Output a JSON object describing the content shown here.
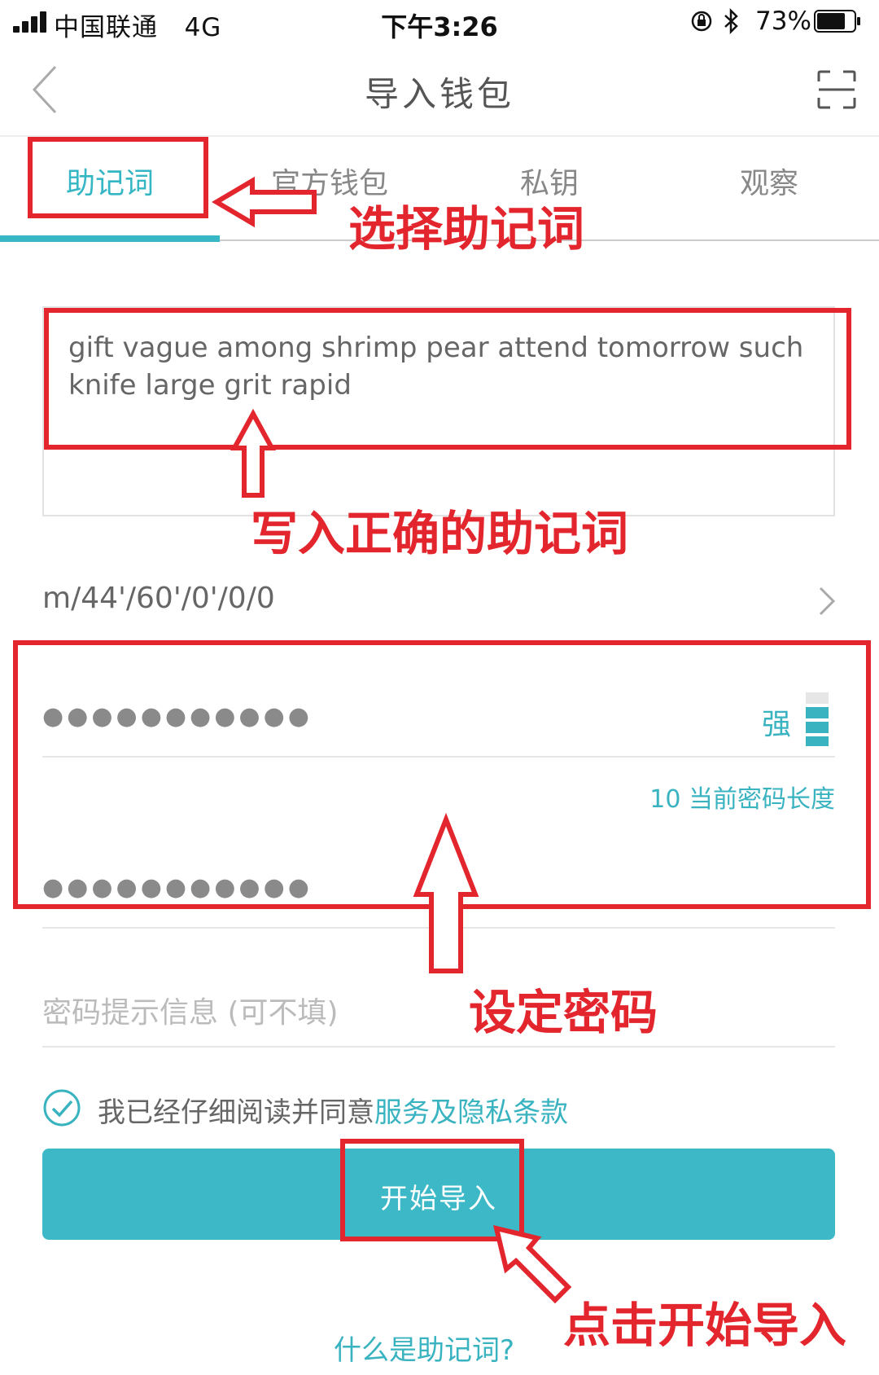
{
  "status_bar": {
    "carrier": "中国联通",
    "network": "4G",
    "time": "下午3:26",
    "battery": "73%"
  },
  "nav": {
    "title": "导入钱包",
    "back_icon": "chevron-left-icon",
    "scan_icon": "scan-icon"
  },
  "tabs": [
    {
      "label": "助记词",
      "active": true
    },
    {
      "label": "官方钱包",
      "active": false
    },
    {
      "label": "私钥",
      "active": false
    },
    {
      "label": "观察",
      "active": false
    }
  ],
  "mnemonic": {
    "value": "gift vague among shrimp pear attend tomorrow such knife large grit rapid"
  },
  "derivation_path": {
    "value": "m/44'/60'/0'/0/0"
  },
  "password": {
    "value_mask": "●●●●●●●●●●●",
    "strength_label": "强",
    "length_text": "10 当前密码长度",
    "confirm_mask": "●●●●●●●●●●●"
  },
  "hint": {
    "placeholder": "密码提示信息 (可不填)"
  },
  "agreement": {
    "text": "我已经仔细阅读并同意",
    "link": "服务及隐私条款",
    "checked": true
  },
  "start_button": {
    "label": "开始导入"
  },
  "help_link": {
    "label": "什么是助记词?"
  },
  "annotations": {
    "select_mnemonic": "选择助记词",
    "enter_mnemonic": "写入正确的助记词",
    "set_password": "设定密码",
    "click_import": "点击开始导入"
  },
  "colors": {
    "accent": "#3db8c6",
    "annotation": "#e3262d"
  }
}
